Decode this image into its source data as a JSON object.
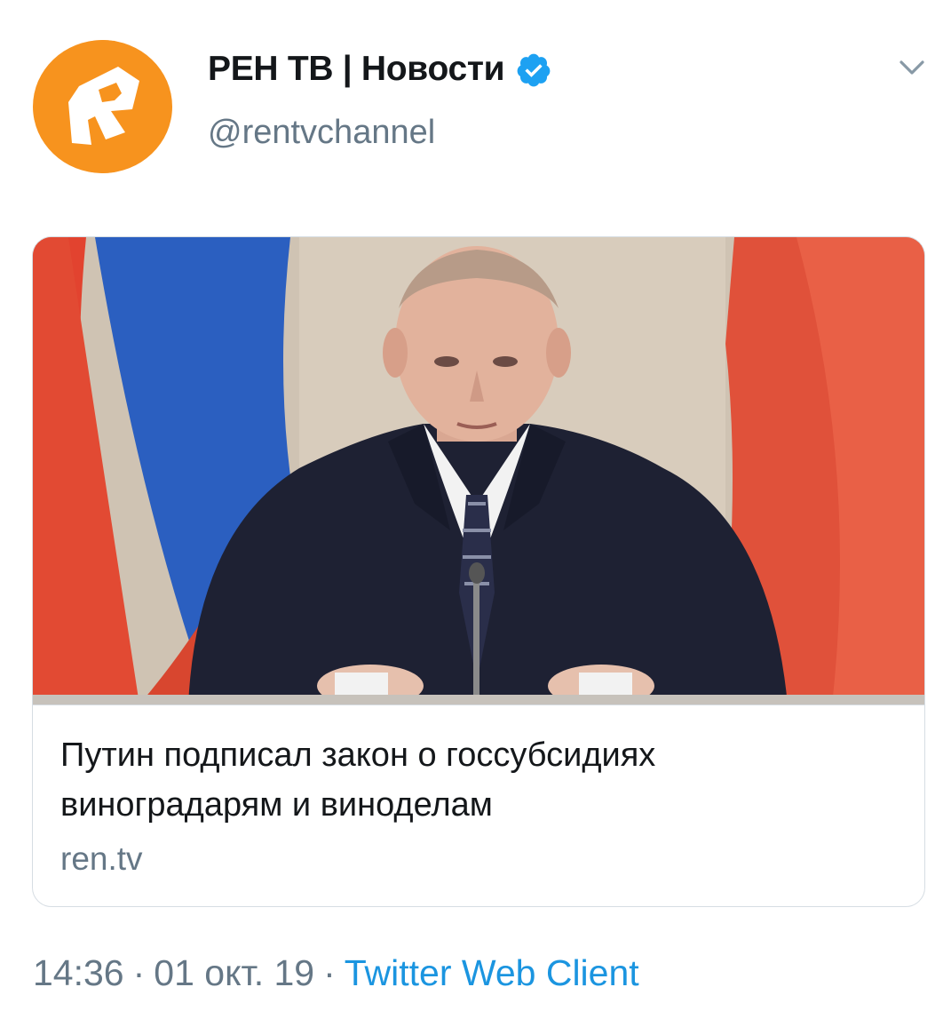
{
  "tweet": {
    "author": {
      "display_name": "РЕН ТВ | Новости",
      "handle": "@rentvchannel",
      "verified": true,
      "avatar_icon": "ren-tv-logo-icon",
      "avatar_color": "#f7931e"
    },
    "menu_icon": "chevron-down-icon",
    "card": {
      "image_alt": "news-photo",
      "title": "Путин подписал закон о госсубсидиях виноградарям и виноделам",
      "domain": "ren.tv"
    },
    "meta": {
      "time": "14:36",
      "separator": "·",
      "date": "01 окт. 19",
      "source": "Twitter Web Client"
    }
  },
  "colors": {
    "text_primary": "#14171a",
    "text_secondary": "#657786",
    "link": "#1b95e0",
    "verified": "#1da1f2",
    "card_border": "#d6dde3"
  }
}
